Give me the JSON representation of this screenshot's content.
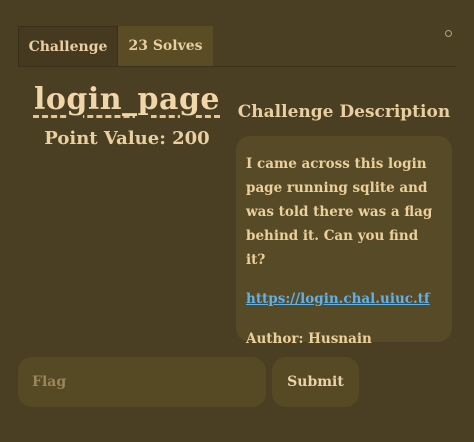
{
  "tabs": [
    {
      "label": "Challenge",
      "active": true
    },
    {
      "label": "23 Solves",
      "active": false
    }
  ],
  "challenge": {
    "name": "login_page",
    "points": "Point Value: 200"
  },
  "description": {
    "heading": "Challenge Description",
    "text": "I came across this login page running sqlite and was told there was a flag behind it. Can you find it?",
    "link": "https://login.chal.uiuc.tf",
    "author": "Author: Husnain"
  },
  "form": {
    "flag_placeholder": "Flag",
    "submit_label": "Submit"
  },
  "colors": {
    "background": "#4a3f22",
    "panel": "#574a26",
    "text": "#e6c48e",
    "link": "#5eb1ea"
  }
}
